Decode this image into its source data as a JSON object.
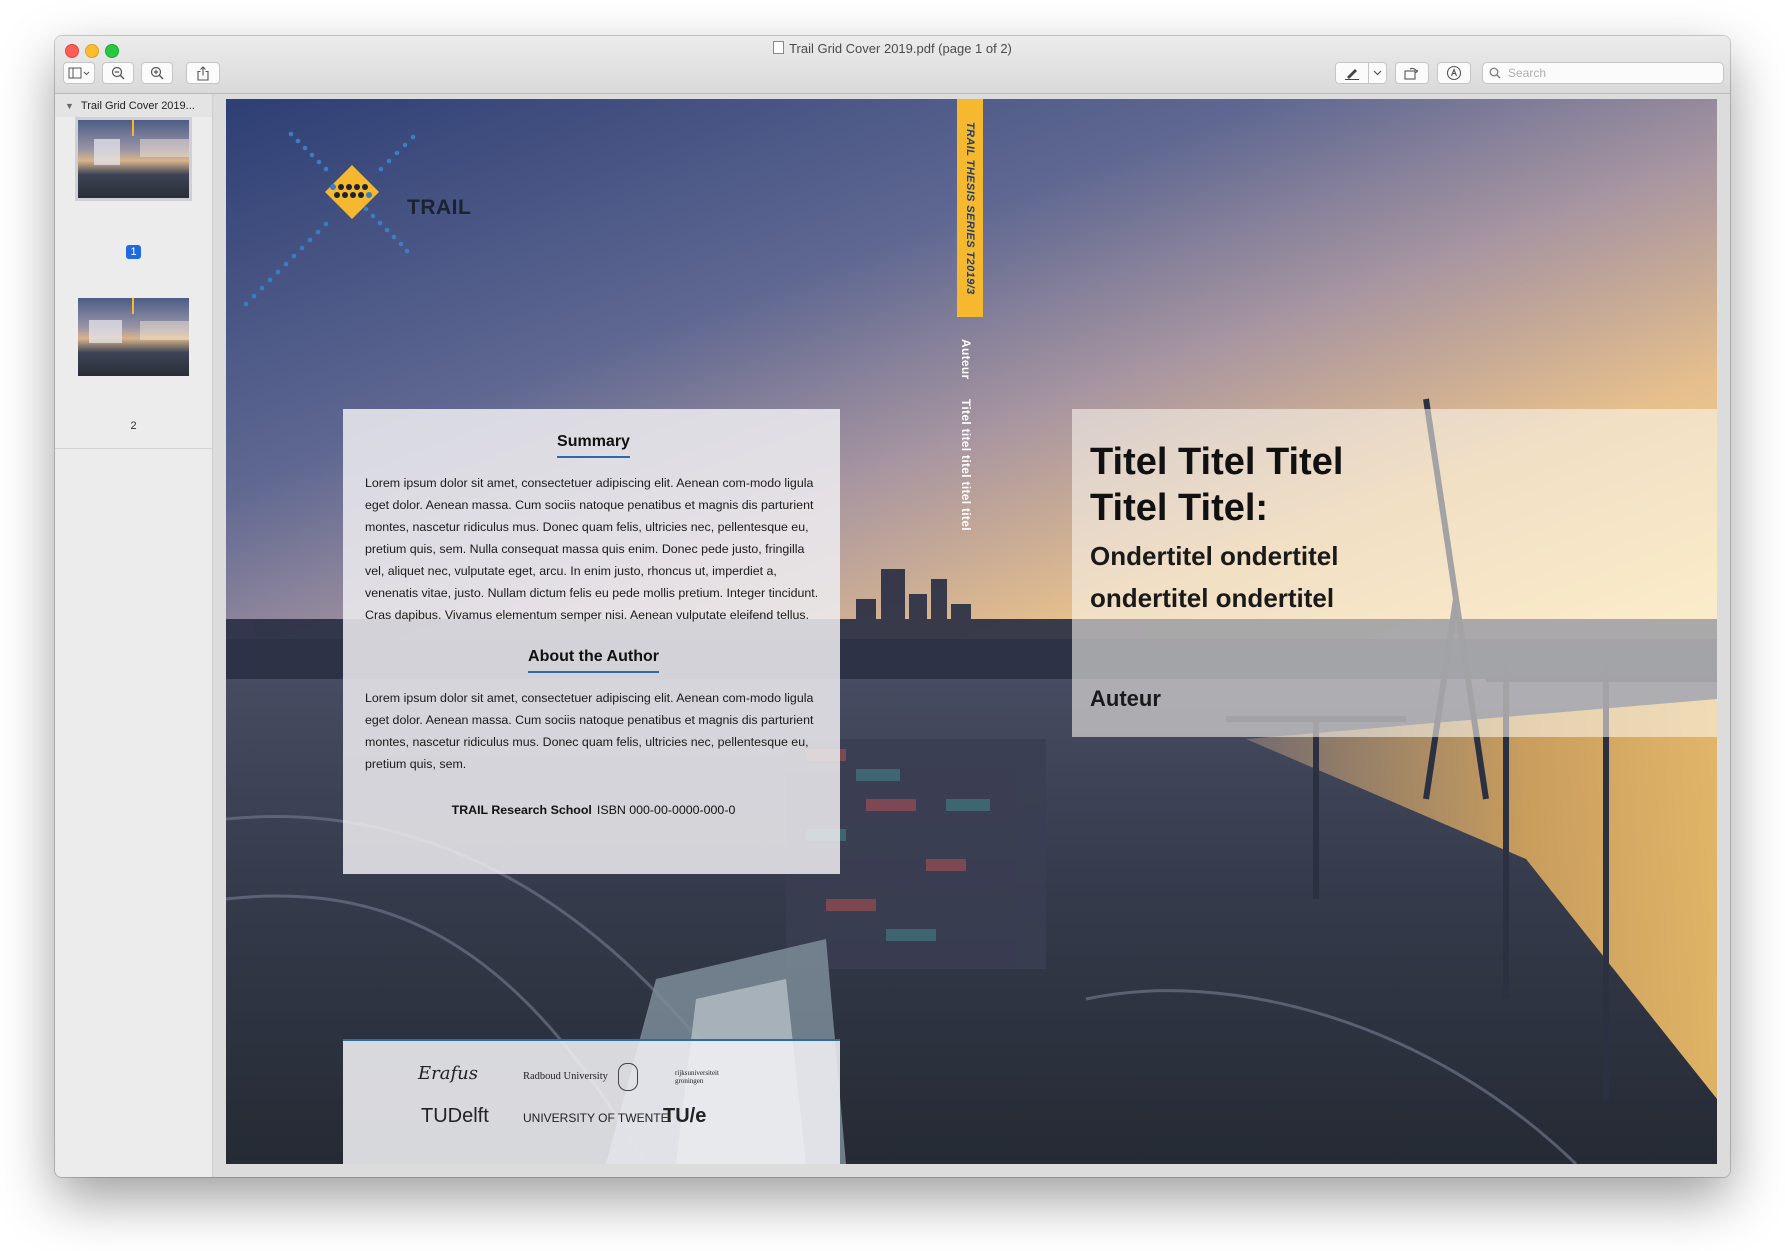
{
  "window": {
    "title": "Trail Grid Cover 2019.pdf (page 1 of 2)"
  },
  "toolbar": {
    "sidebar_toggle_icon": "sidebar-icon",
    "zoom_out_icon": "zoom-out-icon",
    "zoom_in_icon": "zoom-in-icon",
    "share_icon": "share-icon",
    "markup_icon": "pen-icon",
    "rotate_icon": "rotate-icon",
    "annotate_icon": "markup-circle-icon",
    "search_placeholder": "Search"
  },
  "sidebar": {
    "document_name": "Trail Grid Cover 2019...",
    "pages": [
      {
        "number": "1",
        "selected": true
      },
      {
        "number": "2",
        "selected": false
      }
    ]
  },
  "cover": {
    "logo_text": "TRAIL",
    "spine_series": "TRAIL THESIS SERIES T2019/3",
    "spine_author": "Auteur",
    "spine_title": "Titel titel titel titel titel",
    "summary_heading": "Summary",
    "summary_text": "Lorem ipsum dolor sit amet, consectetuer adipiscing elit. Aenean com-modo ligula eget dolor. Aenean massa. Cum sociis natoque penatibus et magnis dis parturient montes, nascetur ridiculus mus. Donec quam felis, ultricies nec, pellentesque eu, pretium quis, sem. Nulla consequat massa quis enim. Donec pede justo, fringilla vel, aliquet nec, vulputate eget, arcu. In enim justo, rhoncus ut, imperdiet a, venenatis vitae, justo. Nullam dictum felis eu pede mollis pretium. Integer tincidunt. Cras dapibus. Vivamus elementum semper nisi. Aenean vulputate eleifend tellus.",
    "author_heading": "About the Author",
    "author_text": "Lorem ipsum dolor sit amet, consectetuer adipiscing elit. Aenean com-modo ligula eget dolor. Aenean massa. Cum sociis natoque penatibus et magnis dis parturient montes, nascetur ridiculus mus. Donec quam felis, ultricies nec, pellentesque eu, pretium quis, sem.",
    "school": "TRAIL Research School",
    "isbn": "ISBN 000-00-0000-000-0",
    "front_title": "Titel Titel Titel Titel Titel:",
    "front_subtitle": "Ondertitel ondertitel ondertitel ondertitel",
    "front_author": "Auteur",
    "logos": {
      "erasmus": "Erafus",
      "radboud": "Radboud University",
      "groningen": "rijksuniversiteit groningen",
      "tudelft": "TUDelft",
      "twente": "UNIVERSITY OF TWENTE.",
      "tue": "TU/e"
    }
  },
  "colors": {
    "accent_blue": "#2f6aa8",
    "spine_yellow": "#f5b82e",
    "selection_blue": "#1f6ae0"
  }
}
